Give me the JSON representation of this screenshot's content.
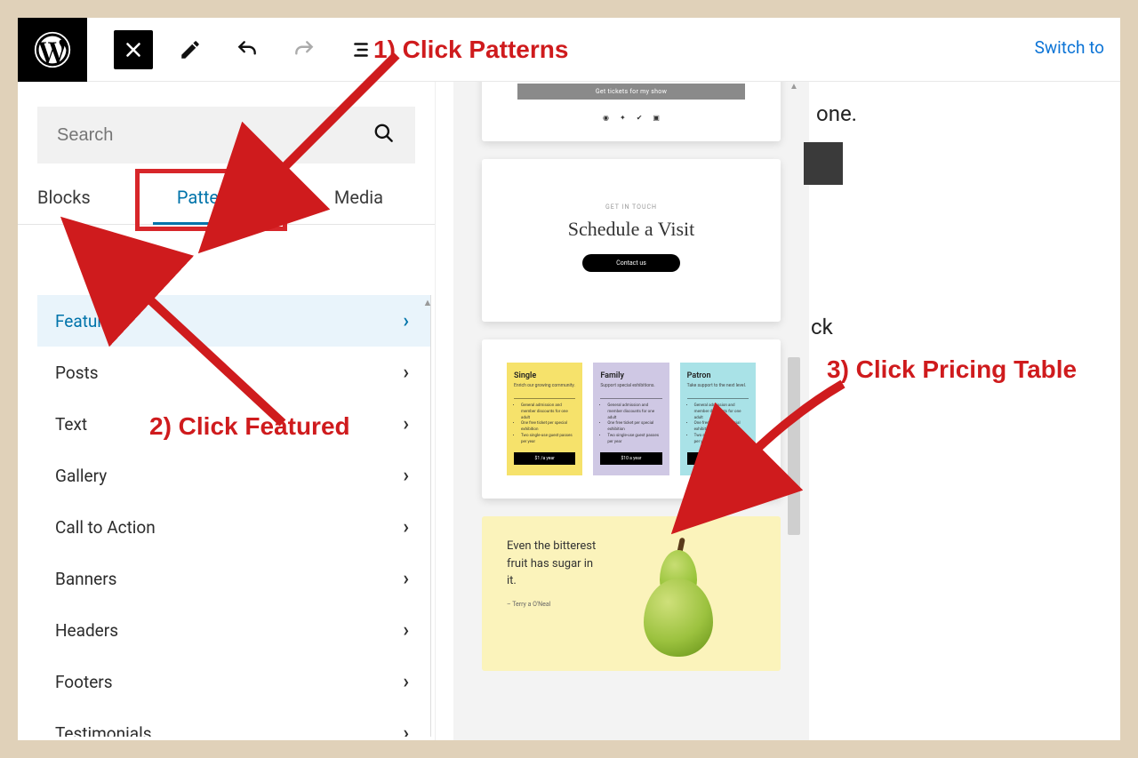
{
  "toolbar": {
    "switch_to": "Switch to"
  },
  "search": {
    "placeholder": "Search"
  },
  "tabs": {
    "blocks": "Blocks",
    "patterns": "Patterns",
    "media": "Media"
  },
  "categories": [
    {
      "label": "Featured",
      "selected": true
    },
    {
      "label": "Posts"
    },
    {
      "label": "Text"
    },
    {
      "label": "Gallery"
    },
    {
      "label": "Call to Action"
    },
    {
      "label": "Banners"
    },
    {
      "label": "Headers"
    },
    {
      "label": "Footers"
    },
    {
      "label": "Testimonials"
    }
  ],
  "preview1": {
    "bar": "Get tickets for my show"
  },
  "preview2": {
    "tiny": "GET IN TOUCH",
    "title": "Schedule a Visit",
    "pill": "Contact us"
  },
  "pricing": {
    "plans": [
      {
        "name": "Single",
        "sub": "Enrich our growing community.",
        "cta": "$1 /a year"
      },
      {
        "name": "Family",
        "sub": "Support special exhibitions.",
        "cta": "$10 a year"
      },
      {
        "name": "Patron",
        "sub": "Take support to the next level.",
        "cta": "$100 /year"
      }
    ],
    "bullets": [
      "General admission and member discounts for one adult",
      "One free ticket per special exhibition",
      "Two single-use guest passes per year"
    ]
  },
  "pear": {
    "quote": "Even the bitterest fruit has sugar in it.",
    "attr": "– Terry a O'Neal"
  },
  "right": {
    "one": "one.",
    "ck": "ck"
  },
  "annotations": {
    "a1": "1) Click Patterns",
    "a2": "2) Click Featured",
    "a3": "3) Click Pricing Table"
  }
}
